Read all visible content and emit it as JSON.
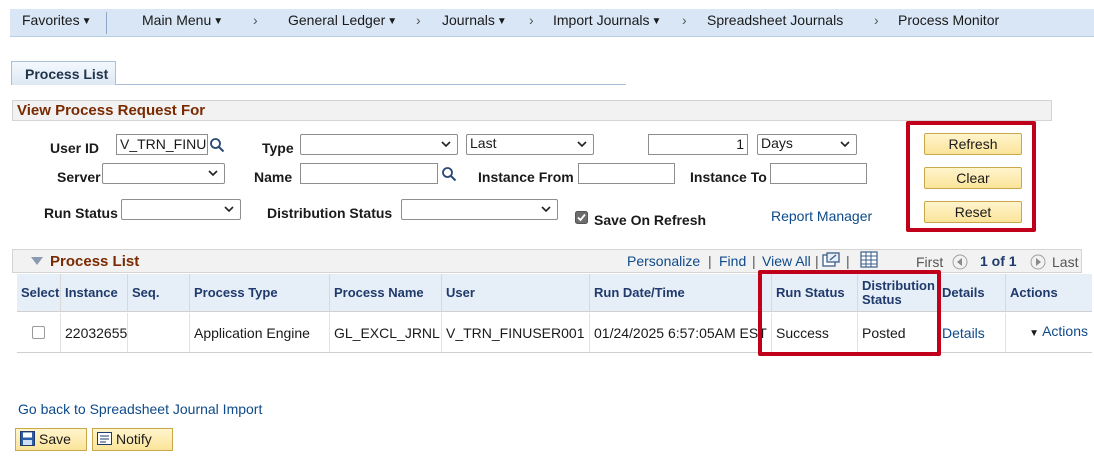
{
  "nav": {
    "favorites": "Favorites",
    "main_menu": "Main Menu",
    "sep": "›",
    "breadcrumbs": [
      "General Ledger",
      "Journals",
      "Import Journals",
      "Spreadsheet Journals",
      "Process Monitor"
    ]
  },
  "tab": {
    "label": "Process List"
  },
  "request": {
    "header": "View Process Request For",
    "user_id_label": "User ID",
    "user_id_value": "V_TRN_FINUSI",
    "type_label": "Type",
    "type_value": "",
    "last_value": "Last",
    "count_value": "1",
    "unit_value": "Days",
    "server_label": "Server",
    "server_value": "",
    "name_label": "Name",
    "name_value": "",
    "instance_from_label": "Instance From",
    "instance_from_value": "",
    "instance_to_label": "Instance To",
    "instance_to_value": "",
    "run_status_label": "Run Status",
    "run_status_value": "",
    "dist_status_label": "Distribution Status",
    "dist_status_value": "",
    "save_on_refresh_label": "Save On Refresh",
    "save_on_refresh_checked": true,
    "report_manager_link": "Report Manager",
    "refresh_button": "Refresh",
    "clear_button": "Clear",
    "reset_button": "Reset"
  },
  "grid": {
    "title": "Process List",
    "personalize": "Personalize",
    "find": "Find",
    "view_all": "View All",
    "pipe": "|",
    "first": "First",
    "range": "1 of 1",
    "last": "Last",
    "columns": {
      "select": "Select",
      "instance": "Instance",
      "seq": "Seq.",
      "process_type": "Process Type",
      "process_name": "Process Name",
      "user": "User",
      "run_datetime": "Run Date/Time",
      "run_status": "Run Status",
      "distribution_status": "Distribution Status",
      "details": "Details",
      "actions": "Actions"
    },
    "rows": [
      {
        "selected": false,
        "instance": "22032655",
        "seq": "",
        "process_type": "Application Engine",
        "process_name": "GL_EXCL_JRNL",
        "user": "V_TRN_FINUSER001",
        "run_datetime": "01/24/2025  6:57:05AM EST",
        "run_status": "Success",
        "distribution_status": "Posted",
        "details": "Details",
        "actions": "Actions"
      }
    ]
  },
  "footer": {
    "back_link": "Go back to Spreadsheet Journal Import",
    "save_button": "Save",
    "notify_button": "Notify"
  },
  "colors": {
    "highlight": "#c0001a",
    "link": "#0e4a8a",
    "section_title": "#7a2a00",
    "button": "#fbe49a",
    "nav_bar": "#d8e6f5"
  }
}
